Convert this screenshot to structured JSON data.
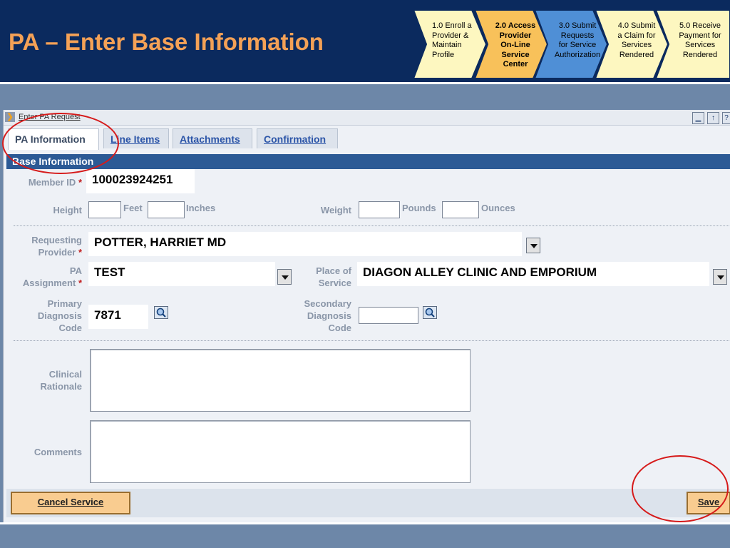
{
  "slide_title": "PA – Enter Base Information",
  "process_steps": [
    {
      "label": "1.0 Enroll a\nProvider &\nMaintain\nProfile",
      "color": "#fdf7c0",
      "active": false
    },
    {
      "label": "2.0 Access\nProvider\nOn-Line\nService\nCenter",
      "color": "#f8c15a",
      "active": true
    },
    {
      "label": "3.0 Submit\nRequests\nfor Service\nAuthorization",
      "color": "#4f8fd6",
      "active": false
    },
    {
      "label": "4.0 Submit\na Claim for\nServices\nRendered",
      "color": "#fdf7c0",
      "active": false
    },
    {
      "label": "5.0 Receive\nPayment for\nServices\nRendered",
      "color": "#fdf7c0",
      "active": false
    }
  ],
  "panel": {
    "title": "Enter PA Request"
  },
  "tabs": [
    {
      "label": "PA Information",
      "active": true
    },
    {
      "label": "Line Items",
      "active": false
    },
    {
      "label": "Attachments",
      "active": false
    },
    {
      "label": "Confirmation",
      "active": false
    }
  ],
  "section_title": "Base Information",
  "form": {
    "member_id_label": "Member ID",
    "member_id_value": "100023924251",
    "height_label": "Height",
    "feet_unit": "Feet",
    "inches_unit": "Inches",
    "weight_label": "Weight",
    "pounds_unit": "Pounds",
    "ounces_unit": "Ounces",
    "requesting_provider_label_1": "Requesting",
    "requesting_provider_label_2": "Provider",
    "requesting_provider_value": "POTTER, HARRIET MD",
    "pa_assignment_label_1": "PA",
    "pa_assignment_label_2": "Assignment",
    "pa_assignment_value": "TEST",
    "place_of_service_label_1": "Place of",
    "place_of_service_label_2": "Service",
    "place_of_service_value": "DIAGON ALLEY CLINIC AND EMPORIUM",
    "primary_dx_label_1": "Primary",
    "primary_dx_label_2": "Diagnosis",
    "primary_dx_label_3": "Code",
    "primary_dx_value": "7871",
    "secondary_dx_label_1": "Secondary",
    "secondary_dx_label_2": "Diagnosis",
    "secondary_dx_label_3": "Code",
    "clinical_rationale_label_1": "Clinical",
    "clinical_rationale_label_2": "Rationale",
    "comments_label": "Comments",
    "required_mark": "*"
  },
  "buttons": {
    "cancel": "Cancel Service",
    "save": "Save"
  },
  "icons": {
    "panel_expand": "chevron-right-icon",
    "minimize": "minimize-icon",
    "restore": "restore-icon",
    "help": "help-icon",
    "lookup": "magnifier-icon"
  },
  "colors": {
    "header_bg": "#0b2a5e",
    "title": "#f4a156",
    "section_bar": "#2c5a95",
    "annotation": "#d61a1a",
    "button": "#f9cc90"
  }
}
